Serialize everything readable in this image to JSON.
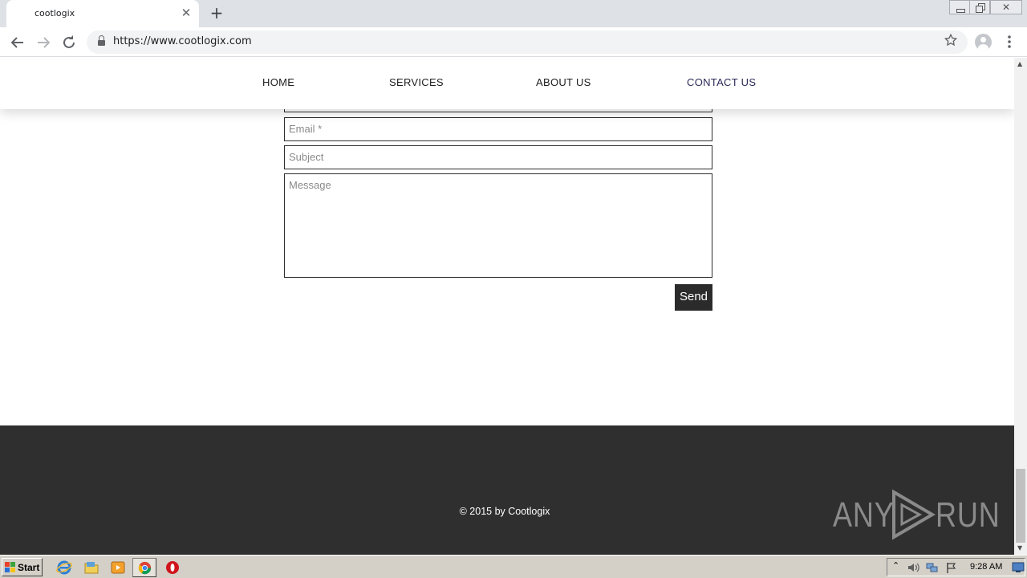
{
  "browser": {
    "tab_title": "cootlogix",
    "tab_close_glyph": "✕",
    "new_tab_glyph": "+",
    "url": "https://www.cootlogix.com",
    "window_close_glyph": "✕",
    "icons": {
      "back": "arrow-left-icon",
      "forward": "arrow-right-icon",
      "reload": "reload-icon",
      "lock": "lock-icon",
      "bookmark": "star-icon",
      "profile": "avatar-icon",
      "menu": "kebab-menu-icon"
    }
  },
  "site": {
    "nav": {
      "home": "HOME",
      "services": "SERVICES",
      "about": "ABOUT US",
      "contact": "CONTACT US"
    },
    "form": {
      "email_placeholder": "Email *",
      "subject_placeholder": "Subject",
      "message_placeholder": "Message",
      "send_label": "Send"
    },
    "footer": {
      "copyright": "© 2015 by Cootlogix"
    },
    "watermark": {
      "left": "ANY",
      "right": "RUN"
    }
  },
  "taskbar": {
    "start_label": "Start",
    "clock": "9:28 AM",
    "apps": [
      "internet-explorer-icon",
      "folder-icon",
      "media-player-icon",
      "chrome-icon",
      "opera-icon"
    ]
  },
  "colors": {
    "footer_bg": "#2f2f2f",
    "send_bg": "#2b2b2b",
    "field_border": "#2d2d2d",
    "tabstrip_bg": "#dee1e6",
    "taskbar_bg": "#d4d0c8"
  }
}
